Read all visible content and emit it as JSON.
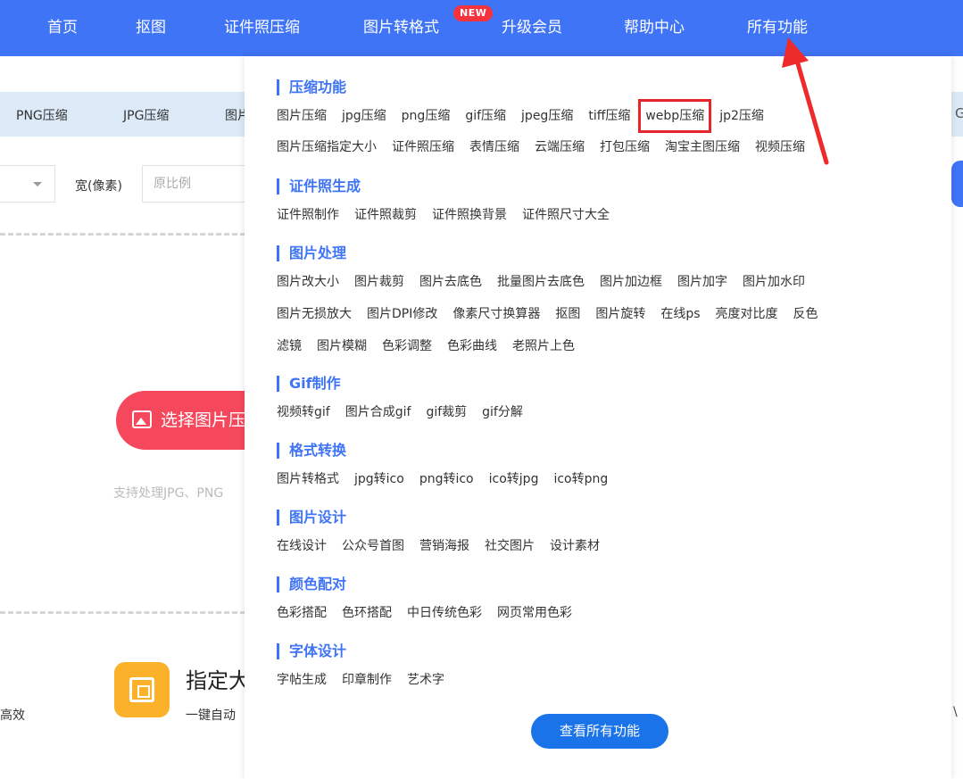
{
  "nav": {
    "items": [
      "首页",
      "抠图",
      "证件照压缩",
      "图片转格式",
      "升级会员",
      "帮助中心",
      "所有功能"
    ],
    "new_badge": "NEW"
  },
  "background": {
    "subbar_items": [
      "PNG压缩",
      "JPG压缩",
      "图片"
    ],
    "width_label": "宽(像素)",
    "width_placeholder": "原比例",
    "select_button": "选择图片压缩",
    "support_text": "支持处理JPG、PNG",
    "feature_title": "指定大小",
    "feature_sub": "一键自动",
    "left_edge_text": "高效",
    "right_edge_g": "G"
  },
  "menu": {
    "sections": [
      {
        "title": "压缩功能",
        "rows": [
          [
            "图片压缩",
            "jpg压缩",
            "png压缩",
            "gif压缩",
            "jpeg压缩",
            "tiff压缩",
            "webp压缩",
            "jp2压缩"
          ],
          [
            "图片压缩指定大小",
            "证件照压缩",
            "表情压缩",
            "云端压缩",
            "打包压缩",
            "淘宝主图压缩",
            "视频压缩"
          ]
        ]
      },
      {
        "title": "证件照生成",
        "rows": [
          [
            "证件照制作",
            "证件照裁剪",
            "证件照换背景",
            "证件照尺寸大全"
          ]
        ]
      },
      {
        "title": "图片处理",
        "rows": [
          [
            "图片改大小",
            "图片裁剪",
            "图片去底色",
            "批量图片去底色",
            "图片加边框",
            "图片加字",
            "图片加水印"
          ],
          [
            "图片无损放大",
            "图片DPI修改",
            "像素尺寸换算器",
            "抠图",
            "图片旋转",
            "在线ps",
            "亮度对比度",
            "反色"
          ],
          [
            "滤镜",
            "图片模糊",
            "色彩调整",
            "色彩曲线",
            "老照片上色"
          ]
        ]
      },
      {
        "title": "Gif制作",
        "rows": [
          [
            "视频转gif",
            "图片合成gif",
            "gif裁剪",
            "gif分解"
          ]
        ]
      },
      {
        "title": "格式转换",
        "rows": [
          [
            "图片转格式",
            "jpg转ico",
            "png转ico",
            "ico转jpg",
            "ico转png"
          ]
        ]
      },
      {
        "title": "图片设计",
        "rows": [
          [
            "在线设计",
            "公众号首图",
            "营销海报",
            "社交图片",
            "设计素材"
          ]
        ]
      },
      {
        "title": "颜色配对",
        "rows": [
          [
            "色彩搭配",
            "色环搭配",
            "中日传统色彩",
            "网页常用色彩"
          ]
        ]
      },
      {
        "title": "字体设计",
        "rows": [
          [
            "字帖生成",
            "印章制作",
            "艺术字"
          ]
        ]
      }
    ],
    "view_all": "查看所有功能"
  },
  "colors": {
    "nav_bg": "#3f74f6",
    "section_title": "#3f74f6",
    "highlight_box": "#e5252b",
    "arrow": "#ee2b2b",
    "view_all_bg": "#1a73e8"
  }
}
